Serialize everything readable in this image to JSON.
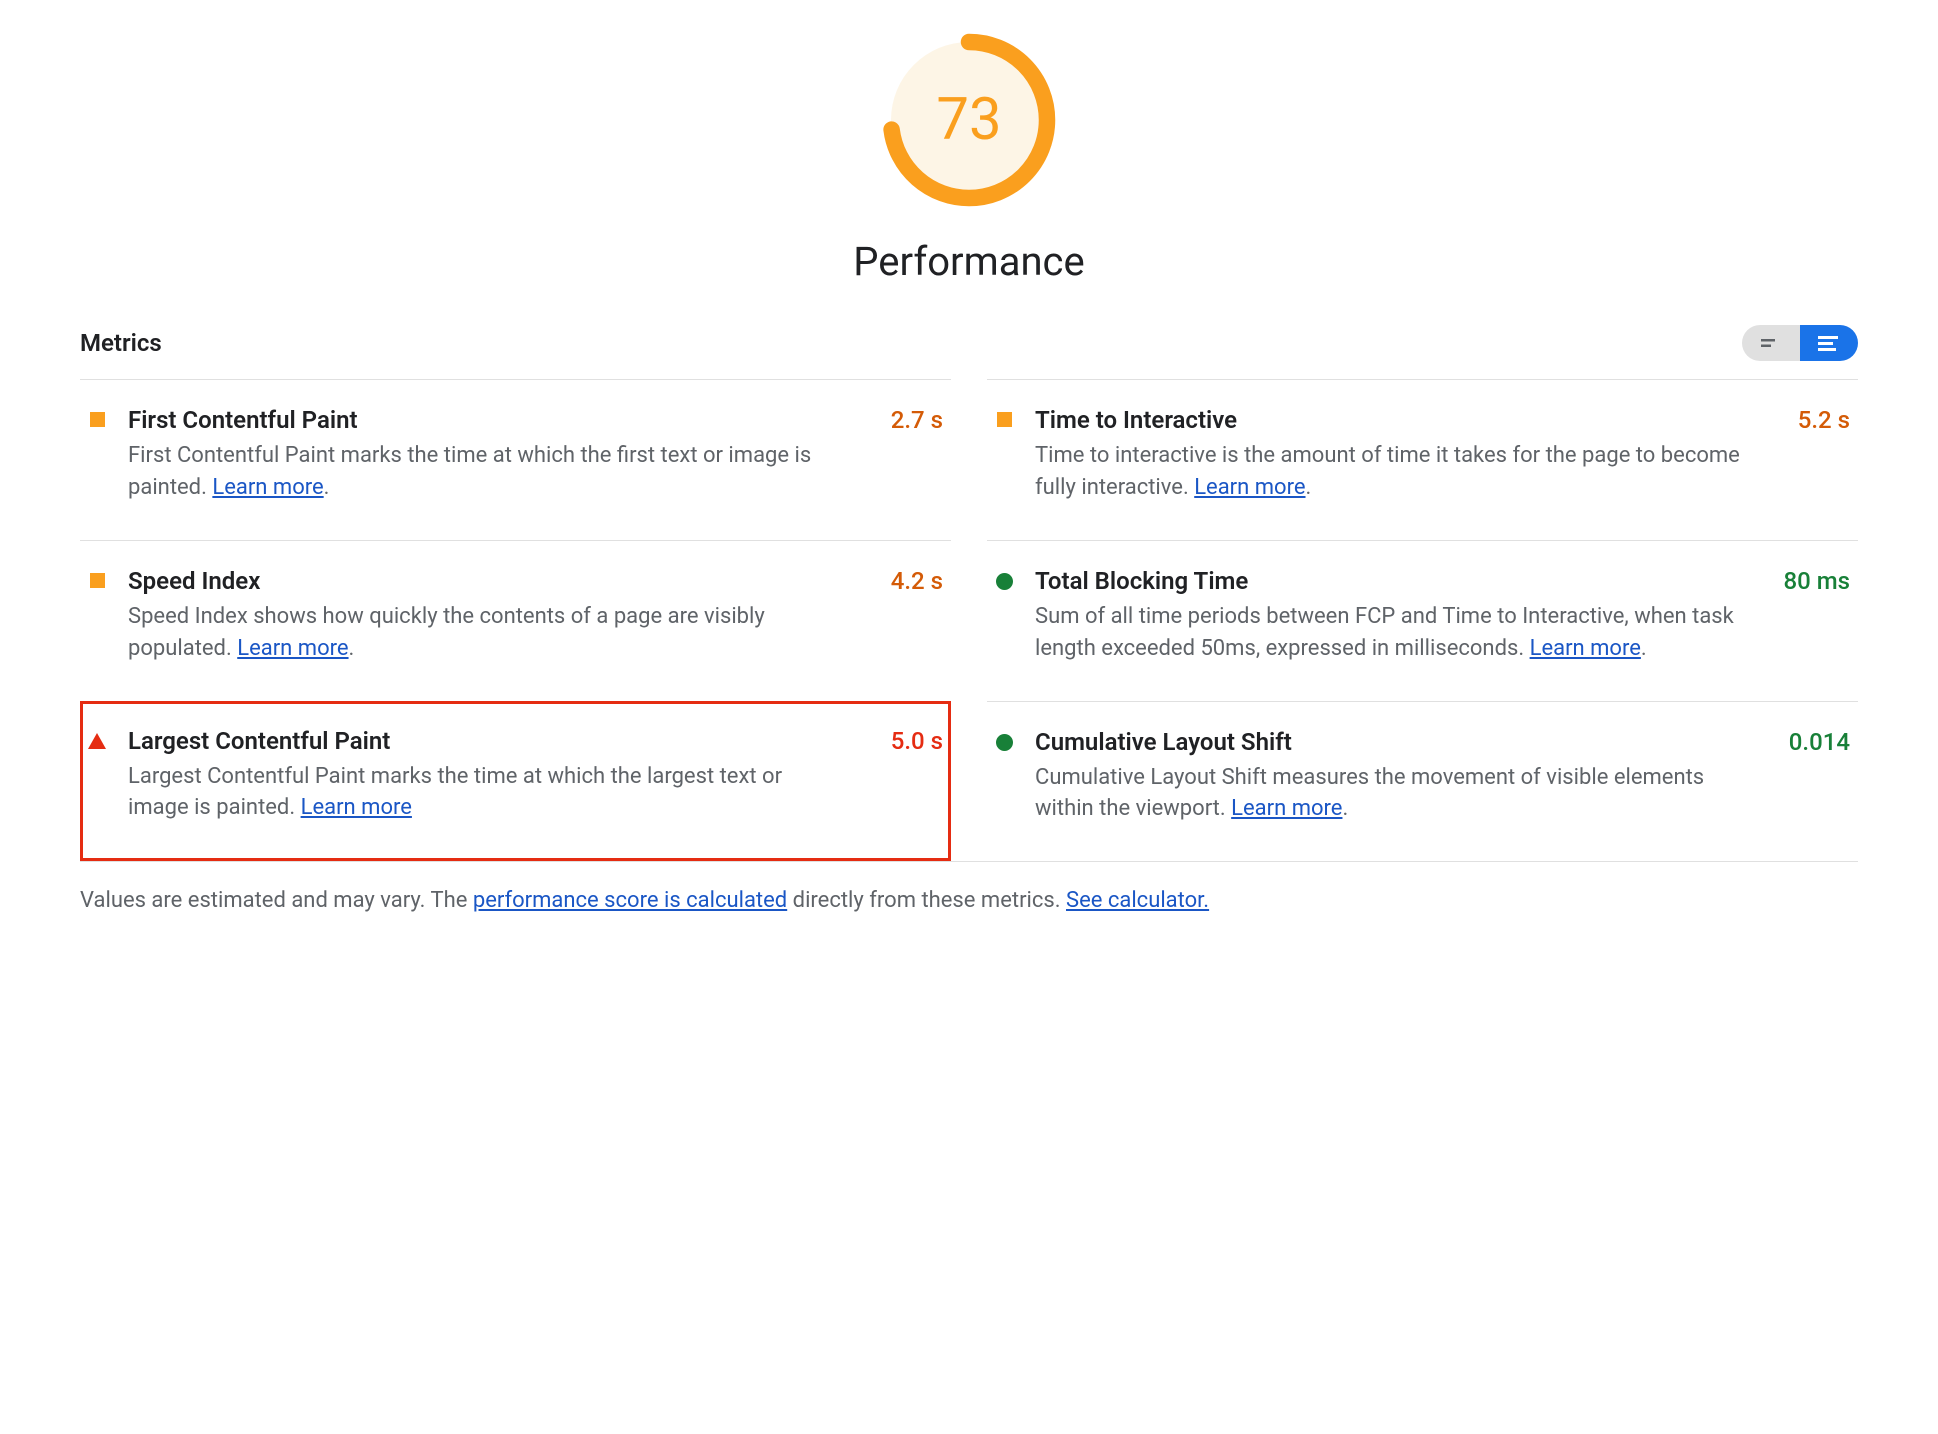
{
  "gauge": {
    "score": "73",
    "score_num": 73,
    "title": "Performance",
    "color": "#fa9f1e"
  },
  "metrics_header": {
    "label": "Metrics"
  },
  "metrics": [
    {
      "title": "First Contentful Paint",
      "desc_pre": "First Contentful Paint marks the time at which the first text or image is painted. ",
      "learn": "Learn more",
      "desc_post": ".",
      "value": "2.7 s",
      "status": "average",
      "value_class": "val-orange"
    },
    {
      "title": "Time to Interactive",
      "desc_pre": "Time to interactive is the amount of time it takes for the page to become fully interactive. ",
      "learn": "Learn more",
      "desc_post": ".",
      "value": "5.2 s",
      "status": "average",
      "value_class": "val-orange"
    },
    {
      "title": "Speed Index",
      "desc_pre": "Speed Index shows how quickly the contents of a page are visibly populated. ",
      "learn": "Learn more",
      "desc_post": ".",
      "value": "4.2 s",
      "status": "average",
      "value_class": "val-orange"
    },
    {
      "title": "Total Blocking Time",
      "desc_pre": "Sum of all time periods between FCP and Time to Interactive, when task length exceeded 50ms, expressed in milliseconds. ",
      "learn": "Learn more",
      "desc_post": ".",
      "value": "80 ms",
      "status": "good",
      "value_class": "val-green"
    },
    {
      "title": "Largest Contentful Paint",
      "desc_pre": "Largest Contentful Paint marks the time at which the largest text or image is painted. ",
      "learn": "Learn more",
      "desc_post": "",
      "value": "5.0 s",
      "status": "poor",
      "value_class": "val-red",
      "highlighted": true
    },
    {
      "title": "Cumulative Layout Shift",
      "desc_pre": "Cumulative Layout Shift measures the movement of visible elements within the viewport. ",
      "learn": "Learn more",
      "desc_post": ".",
      "value": "0.014",
      "status": "good",
      "value_class": "val-green"
    }
  ],
  "footer": {
    "text_pre": "Values are estimated and may vary. The ",
    "link1": "performance score is calculated",
    "text_mid": " directly from these metrics. ",
    "link2": "See calculator."
  }
}
